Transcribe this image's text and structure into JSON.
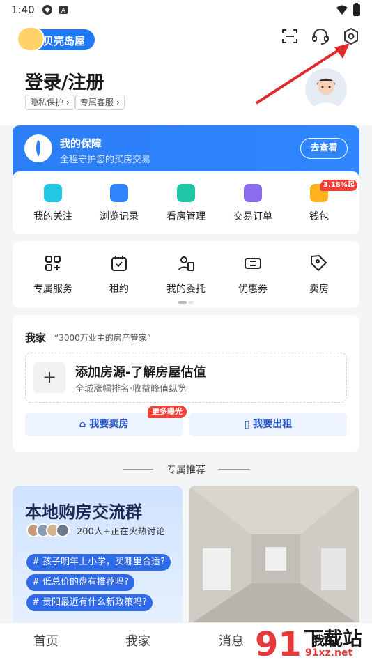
{
  "status_bar": {
    "time": "1:40"
  },
  "app": {
    "name": "贝壳岛屋"
  },
  "header": {
    "title": "登录/注册",
    "privacy_label": "隐私保护",
    "service_label": "专属客服"
  },
  "protection": {
    "title": "我的保障",
    "subtitle": "全程守护您的买房交易",
    "button": "去查看"
  },
  "quick_items": [
    {
      "label": "我的关注",
      "icon": "heart-icon",
      "color": "#23c7e4"
    },
    {
      "label": "浏览记录",
      "icon": "chat-bubble-icon",
      "color": "#2f86ff"
    },
    {
      "label": "看房管理",
      "icon": "camera-icon",
      "color": "#1fc6a5"
    },
    {
      "label": "交易订单",
      "icon": "clipboard-check-icon",
      "color": "#8a6cf0"
    },
    {
      "label": "钱包",
      "icon": "wallet-icon",
      "color": "#ffb21e"
    }
  ],
  "wallet_badge": "3.18%起",
  "services": [
    {
      "label": "专属服务",
      "icon": "grid-icon"
    },
    {
      "label": "租约",
      "icon": "calendar-check-icon"
    },
    {
      "label": "我的委托",
      "icon": "person-document-icon"
    },
    {
      "label": "优惠券",
      "icon": "coupon-icon"
    },
    {
      "label": "卖房",
      "icon": "price-tag-icon"
    }
  ],
  "my_home": {
    "title": "我家",
    "slogan": "“3000万业主的房产管家”",
    "add_title": "添加房源-了解房屋估值",
    "add_sub": "全城涨幅排名·收益峰值纵览",
    "plus": "+",
    "sell_button": "我要卖房",
    "rent_button": "我要出租",
    "promo_badge": "更多曝光"
  },
  "recommend": {
    "heading": "专属推荐",
    "group": {
      "title": "本地购房交流群",
      "count": "200人+正在火热讨论",
      "tags": [
        "# 孩子明年上小学，买哪里合适?",
        "# 低总价的盘有推荐吗?",
        "# 贵阳最近有什么新政策吗?"
      ]
    }
  },
  "tabs": [
    "首页",
    "我家",
    "消息",
    "我的"
  ],
  "watermark": {
    "text": "下载站",
    "url_text": "91xz.net"
  },
  "colors": {
    "accent": "#2c7df6",
    "arrow": "#e02a2a",
    "badge": "#f2413b"
  }
}
